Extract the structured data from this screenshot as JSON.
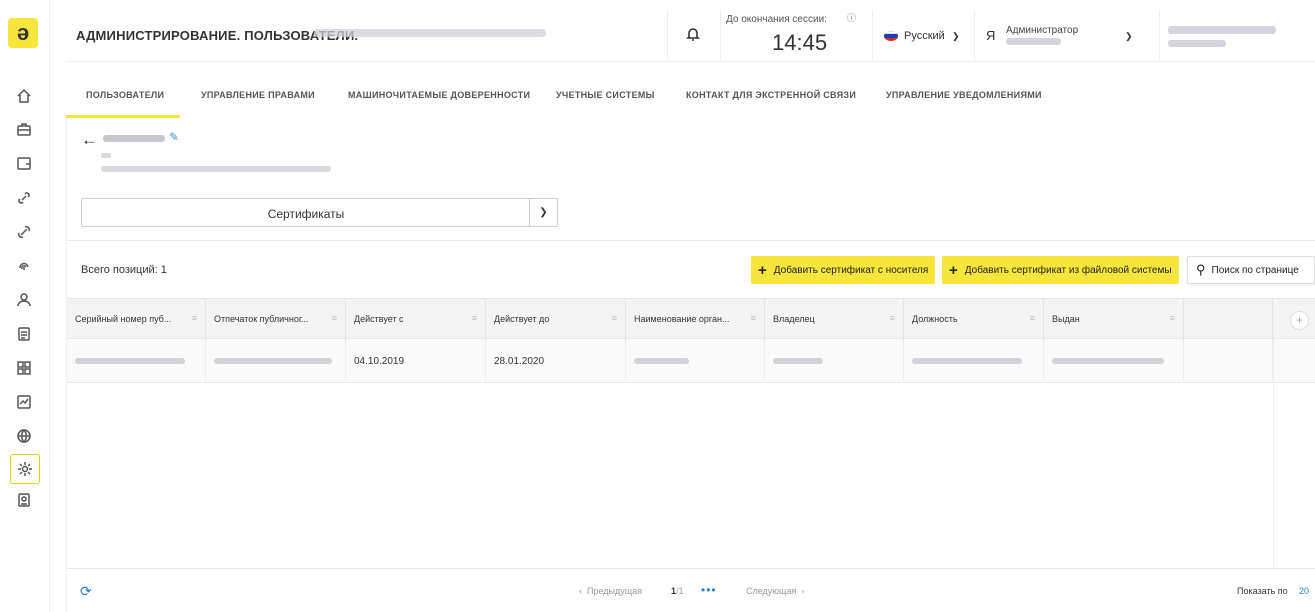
{
  "header": {
    "title": "АДМИНИСТРИРОВАНИЕ. ПОЛЬЗОВАТЕЛИ.",
    "session_label": "До окончания сессии:",
    "session_info_icon": "ⓘ",
    "session_time": "14:45",
    "language": "Русский",
    "user_role": "Администратор"
  },
  "tabs": [
    {
      "label": "ПОЛЬЗОВАТЕЛИ"
    },
    {
      "label": "УПРАВЛЕНИЕ ПРАВАМИ"
    },
    {
      "label": "МАШИНОЧИТАЕМЫЕ ДОВЕРЕННОСТИ"
    },
    {
      "label": "УЧЕТНЫЕ СИСТЕМЫ"
    },
    {
      "label": "КОНТАКТ ДЛЯ ЭКСТРЕННОЙ СВЯЗИ"
    },
    {
      "label": "УПРАВЛЕНИЕ УВЕДОМЛЕНИЯМИ"
    }
  ],
  "section_select": {
    "value": "Сертификаты"
  },
  "toolbar": {
    "total_label": "Всего позиций: 1",
    "add_from_media": "Добавить сертификат с носителя",
    "add_from_file": "Добавить сертификат из файловой системы",
    "search": "Поиск по странице"
  },
  "table": {
    "columns": [
      "Серийный номер пуб...",
      "Отпечаток публичног...",
      "Действует с",
      "Действует до",
      "Наименование орган...",
      "Владелец",
      "Должность",
      "Выдан"
    ],
    "rows": [
      {
        "valid_from": "04.10.2019",
        "valid_to": "28.01.2020"
      }
    ]
  },
  "pagination": {
    "prev": "Предыдущая",
    "current": "1",
    "total": "/1",
    "dots": "•••",
    "next": "Следующая",
    "show_label": "Показать по",
    "show_value": "20"
  },
  "colors": {
    "accent": "#f6e53b",
    "link": "#2a7ec9"
  },
  "icons": [
    "logo-icon",
    "home-icon",
    "briefcase-icon",
    "wallet-icon",
    "link-icon",
    "chain-icon",
    "fingerprint-icon",
    "user-icon",
    "document-icon",
    "grid-icon",
    "chart-icon",
    "globe-icon",
    "settings-icon",
    "book-icon",
    "bell-icon",
    "back-arrow-icon",
    "pencil-icon",
    "refresh-icon",
    "search-icon"
  ]
}
